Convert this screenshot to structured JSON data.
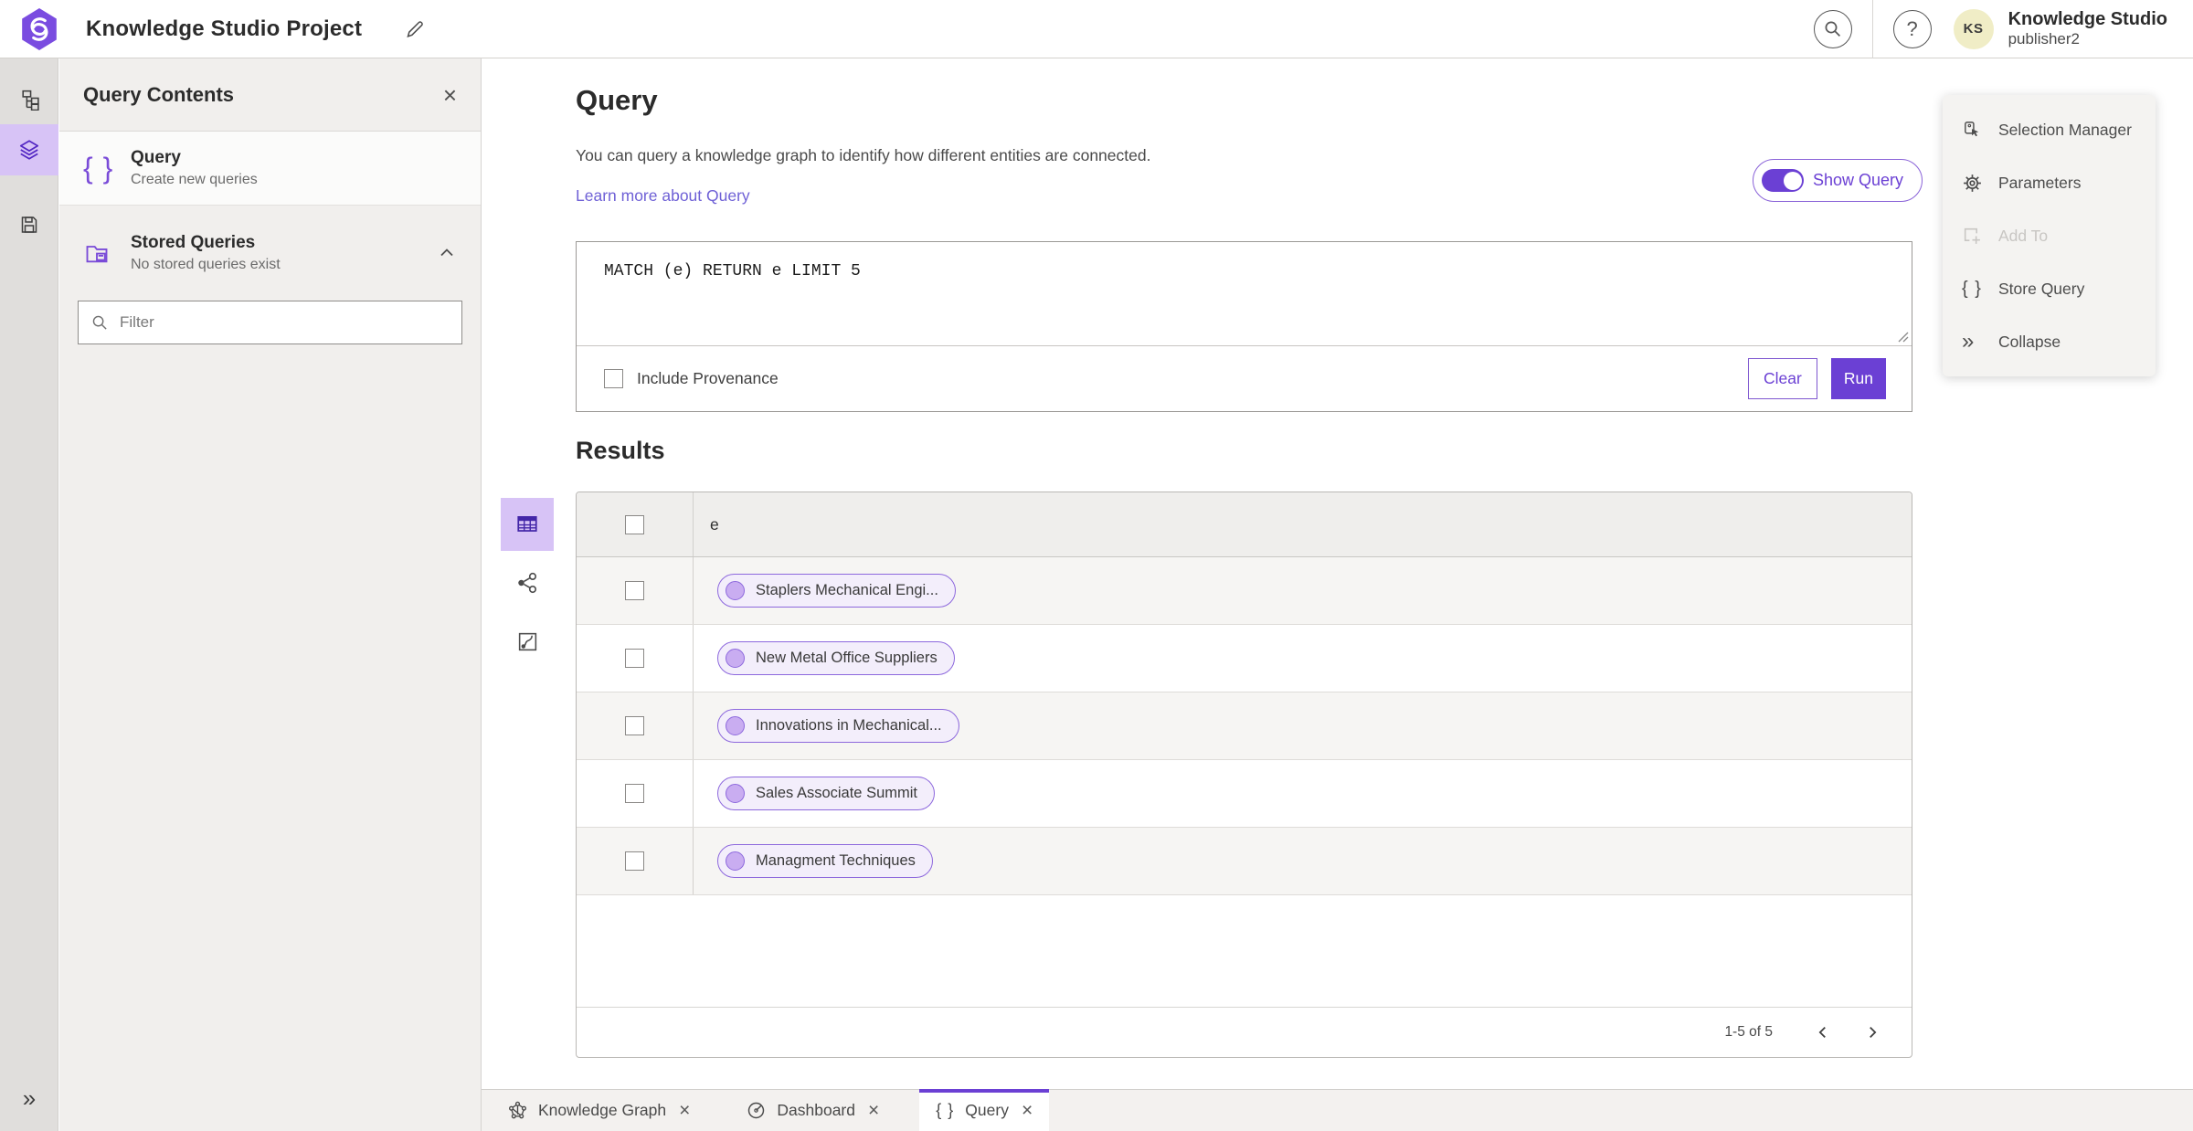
{
  "colors": {
    "accent": "#6b40d4",
    "accent_light_bg": "#d7c3f6",
    "chip_bg": "#f3eefb",
    "chip_border": "#8d68dd",
    "avatar_bg": "#f0edc6"
  },
  "header": {
    "title": "Knowledge Studio Project",
    "account_name": "Knowledge Studio",
    "account_user": "publisher2",
    "avatar_initials": "KS"
  },
  "icons": {
    "help_glyph": "?",
    "close_glyph": "×",
    "braces_glyph": "{ }",
    "collapse_glyph": "»",
    "expand_glyph": "»"
  },
  "side_panel": {
    "title": "Query Contents",
    "query_item": {
      "label": "Query",
      "sublabel": "Create new queries"
    },
    "stored_item": {
      "label": "Stored Queries",
      "sublabel": "No stored queries exist"
    },
    "filter_placeholder": "Filter"
  },
  "query": {
    "heading": "Query",
    "description": "You can query a knowledge graph to identify how different entities are connected.",
    "learn_more": "Learn more about Query",
    "show_query": "Show Query",
    "text": "MATCH (e) RETURN e LIMIT 5",
    "include_provenance": "Include Provenance",
    "clear": "Clear",
    "run": "Run"
  },
  "results": {
    "heading": "Results",
    "column_e": "e",
    "rows": [
      "Staplers Mechanical Engi...",
      "New Metal Office Suppliers",
      "Innovations in Mechanical...",
      "Sales Associate Summit",
      "Managment Techniques"
    ],
    "pagination": "1-5 of 5"
  },
  "tools": {
    "selection_manager": "Selection Manager",
    "parameters": "Parameters",
    "add_to": "Add To",
    "store_query": "Store Query",
    "collapse": "Collapse"
  },
  "tabs": {
    "knowledge_graph": "Knowledge Graph",
    "dashboard": "Dashboard",
    "query": "Query"
  }
}
